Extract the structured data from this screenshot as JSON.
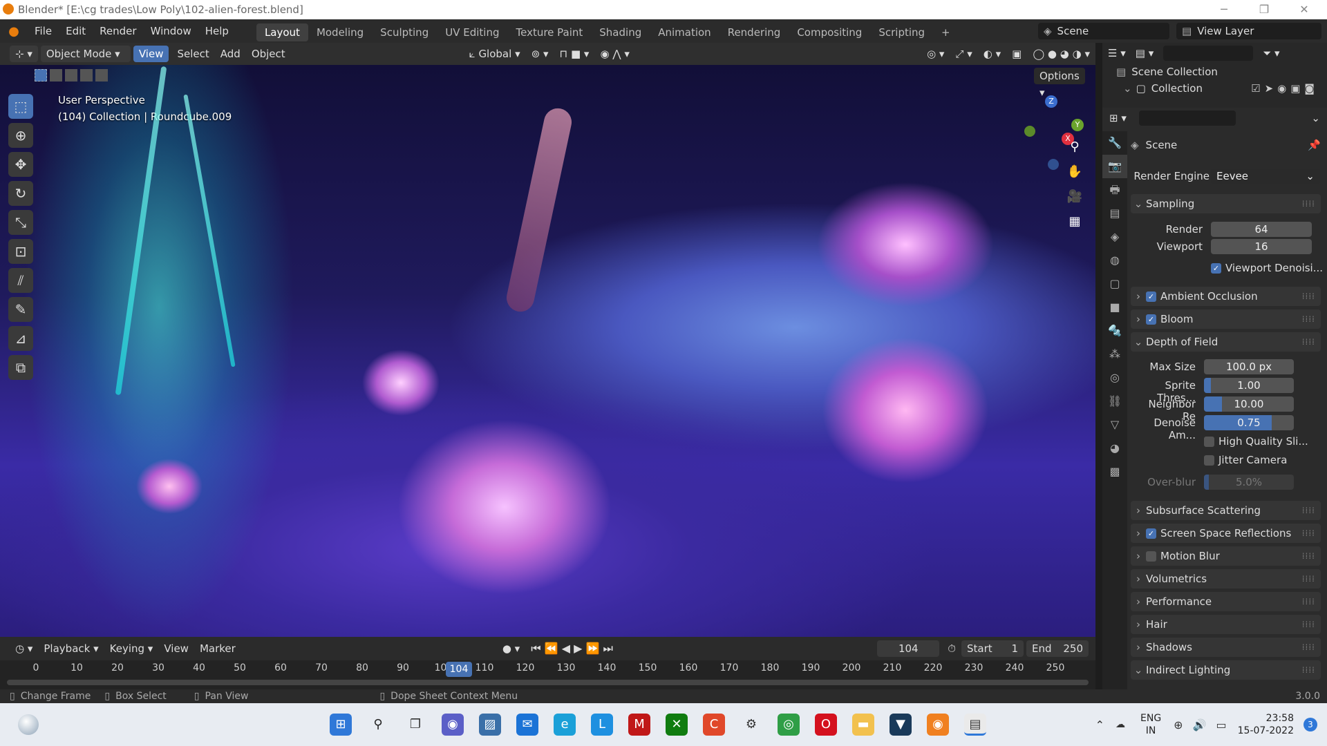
{
  "window": {
    "title": "Blender* [E:\\cg trades\\Low Poly\\102-alien-forest.blend]",
    "minimize": "─",
    "maximize": "❐",
    "close": "✕"
  },
  "menu": [
    "File",
    "Edit",
    "Render",
    "Window",
    "Help"
  ],
  "workspaces": [
    "Layout",
    "Modeling",
    "Sculpting",
    "UV Editing",
    "Texture Paint",
    "Shading",
    "Animation",
    "Rendering",
    "Compositing",
    "Scripting",
    "+"
  ],
  "scene_label": "Scene",
  "view_layer_label": "View Layer",
  "header3d": {
    "mode": "Object Mode",
    "view": "View",
    "select": "Select",
    "add": "Add",
    "object": "Object",
    "transform": "Global",
    "options": "Options"
  },
  "viewport": {
    "line1": "User Perspective",
    "line2": "(104) Collection | Roundcube.009",
    "gizmo_x": "X",
    "gizmo_y": "Y",
    "gizmo_z": "Z"
  },
  "timeline": {
    "playback": "Playback",
    "keying": "Keying",
    "view": "View",
    "marker": "Marker",
    "current": "104",
    "start_label": "Start",
    "start": "1",
    "end_label": "End",
    "end": "250",
    "ticks": [
      "0",
      "10",
      "20",
      "30",
      "40",
      "50",
      "60",
      "70",
      "80",
      "90",
      "100",
      "110",
      "120",
      "130",
      "140",
      "150",
      "160",
      "170",
      "180",
      "190",
      "200",
      "210",
      "220",
      "230",
      "240",
      "250"
    ]
  },
  "status": {
    "change_frame": "Change Frame",
    "box_select": "Box Select",
    "pan_view": "Pan View",
    "context": "Dope Sheet Context Menu",
    "version": "3.0.0"
  },
  "outliner": {
    "scene_collection": "Scene Collection",
    "collection": "Collection"
  },
  "properties": {
    "scene": "Scene",
    "render_engine_label": "Render Engine",
    "render_engine": "Eevee",
    "sampling": "Sampling",
    "render_label": "Render",
    "render": "64",
    "viewport_label": "Viewport",
    "viewport": "16",
    "viewport_denoise": "Viewport Denoisi...",
    "ambient_occlusion": "Ambient Occlusion",
    "bloom": "Bloom",
    "dof": "Depth of Field",
    "max_size_label": "Max Size",
    "max_size": "100.0 px",
    "sprite_label": "Sprite Thres...",
    "sprite": "1.00",
    "neighbor_label": "Neighbor Re",
    "neighbor": "10.00",
    "denoise_label": "Denoise Am...",
    "denoise": "0.75",
    "high_quality": "High Quality Sli...",
    "jitter": "Jitter Camera",
    "overblur_label": "Over-blur",
    "overblur": "5.0%",
    "sss": "Subsurface Scattering",
    "ssr": "Screen Space Reflections",
    "motion_blur": "Motion Blur",
    "volumetrics": "Volumetrics",
    "performance": "Performance",
    "hair": "Hair",
    "shadows": "Shadows",
    "indirect": "Indirect Lighting"
  },
  "taskbar": {
    "lang1": "ENG",
    "lang2": "IN",
    "time": "23:58",
    "date": "15-07-2022",
    "notif": "3"
  }
}
